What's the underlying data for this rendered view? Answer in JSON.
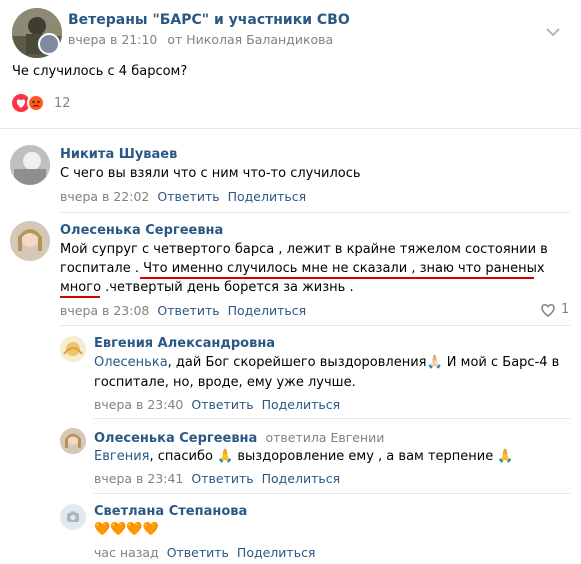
{
  "post": {
    "group_name": "Ветераны \"БАРС\" и участники СВО",
    "time": "вчера в 21:10",
    "from": "от Николая Баландикова",
    "text": "Че случилось с 4 барсом?",
    "reactions_count": "12"
  },
  "comments": [
    {
      "author": "Никита Шуваев",
      "text": "С чего вы взяли что с ним что-то случилось",
      "time": "вчера в 22:02",
      "reply": "Ответить",
      "share": "Поделиться"
    },
    {
      "author": "Олесенька Сергеевна",
      "text_line1": "Мой супруг с четвертого барса , лежит в крайне тяжелом состоянии в",
      "text_line2": "госпитале . Что именно случилось мне не сказали , знаю что раненых",
      "text_line3": "много .четвертый день борется за жизнь .",
      "time": "вчера в 23:08",
      "reply": "Ответить",
      "share": "Поделиться",
      "likes": "1"
    }
  ],
  "replies": [
    {
      "author": "Евгения Александровна",
      "mention": "Олесенька",
      "text_line1": ", дай Бог скорейшего выздоровления🙏🏻 И мой с Барс-4 в",
      "text_line2": "госпитале, но, вроде, ему уже лучше.",
      "time": "вчера в 23:40",
      "reply": "Ответить",
      "share": "Поделиться"
    },
    {
      "author": "Олесенька Сергеевна",
      "replied_to": "ответила Евгении",
      "mention": "Евгения",
      "text": ", спасибо 🙏 выздоровление ему , а вам терпение 🙏",
      "time": "вчера в 23:41",
      "reply": "Ответить",
      "share": "Поделиться"
    },
    {
      "author": "Светлана Степанова",
      "text": "🧡🧡🧡🧡",
      "time": "час назад",
      "reply": "Ответить",
      "share": "Поделиться"
    }
  ],
  "colors": {
    "link": "#2a5885",
    "meta": "#828282",
    "underline": "#d60000"
  },
  "icons": [
    "heart-icon",
    "angry-icon",
    "chevron-down-icon",
    "heart-outline-icon",
    "camera-icon"
  ]
}
